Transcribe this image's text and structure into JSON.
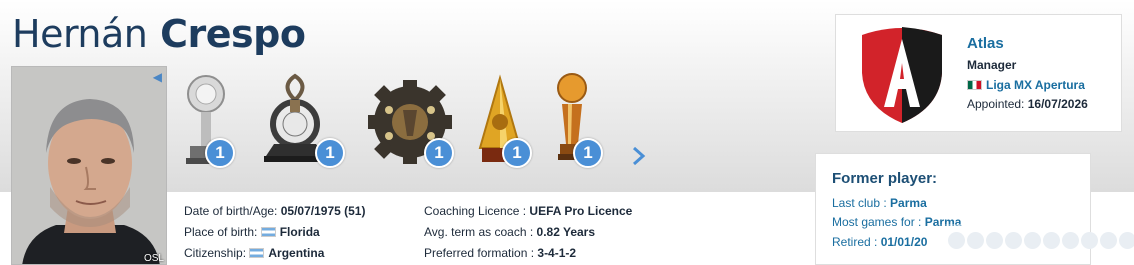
{
  "profile": {
    "first_name": "Hernán",
    "last_name": "Crespo",
    "photo_credit": "OSL"
  },
  "trophies": [
    {
      "icon": "copa-sudamericana-trophy-icon",
      "count": "1"
    },
    {
      "icon": "recopa-sudamericana-trophy-icon",
      "count": "1"
    },
    {
      "icon": "gear-shaped-trophy-icon",
      "count": "1"
    },
    {
      "icon": "golden-triangle-trophy-icon",
      "count": "1"
    },
    {
      "icon": "golden-ball-trophy-icon",
      "count": "1"
    }
  ],
  "info_left": [
    {
      "label": "Date of birth/Age:",
      "value": "05/07/1975 (51)",
      "flag": ""
    },
    {
      "label": "Place of birth:",
      "value": "Florida",
      "flag": "argentina"
    },
    {
      "label": "Citizenship:",
      "value": "Argentina",
      "flag": "argentina"
    }
  ],
  "info_right": [
    {
      "label": "Coaching Licence :",
      "value": "UEFA Pro Licence"
    },
    {
      "label": "Avg. term as coach :",
      "value": "0.82 Years"
    },
    {
      "label": "Preferred formation :",
      "value": "3-4-1-2"
    }
  ],
  "current_club": {
    "name": "Atlas",
    "role": "Manager",
    "league": "Liga MX Apertura",
    "league_flag": "mexico",
    "appointed_label": "Appointed:",
    "appointed_date": "16/07/2026"
  },
  "former_player": {
    "title": "Former player:",
    "last_club_label": "Last club :",
    "last_club": "Parma",
    "most_games_label": "Most games for :",
    "most_games": "Parma",
    "retired_label": "Retired :",
    "retired": "01/01/20"
  },
  "colors": {
    "navy": "#1d3c5e",
    "link_blue": "#1a6ea0",
    "badge_blue": "#4a8fd6",
    "atlas_red": "#d2232a",
    "atlas_black": "#1a1a1a"
  }
}
